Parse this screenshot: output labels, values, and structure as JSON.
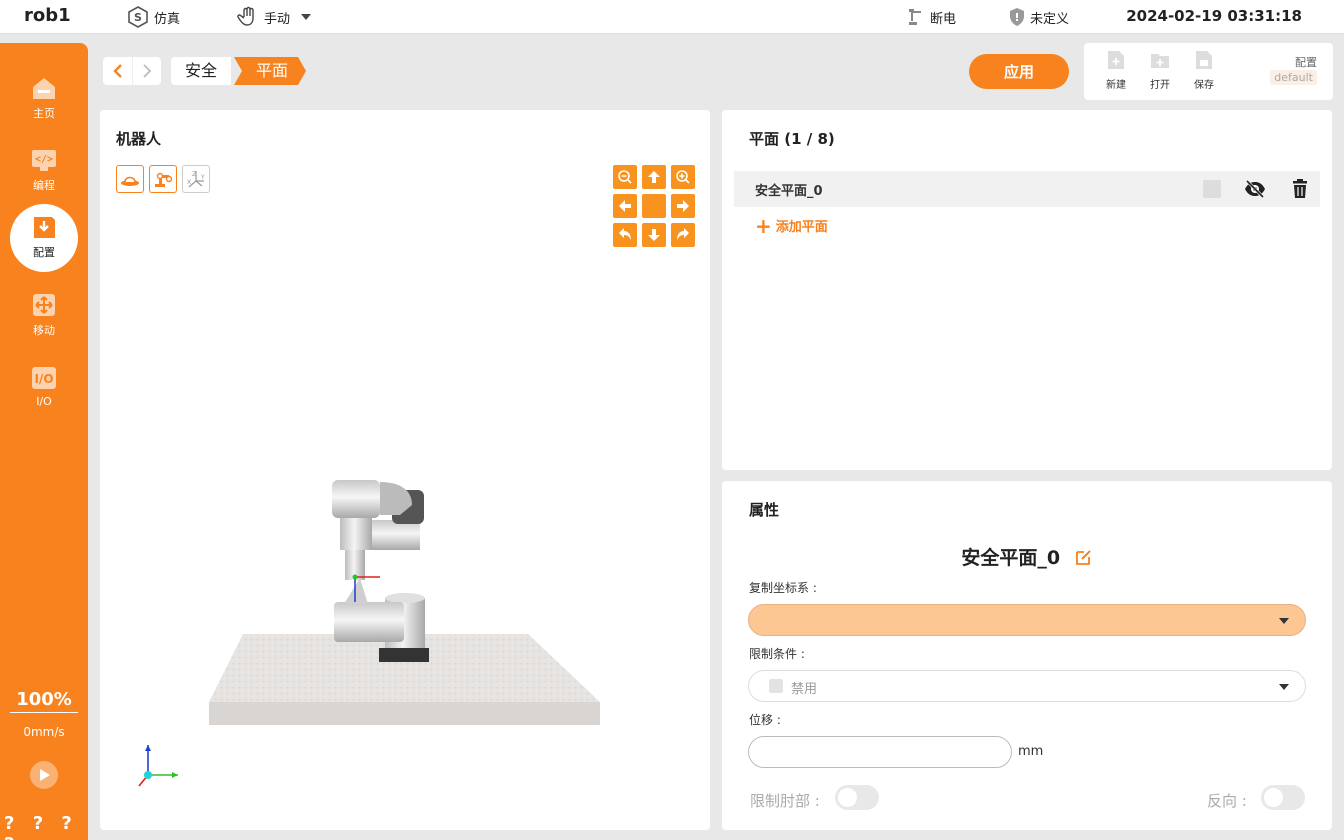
{
  "topbar": {
    "robot_name": "rob1",
    "simulation_label": "仿真",
    "mode_label": "手动",
    "power_label": "断电",
    "safety_label": "未定义",
    "datetime": "2024-02-19 03:31:18"
  },
  "sidebar": {
    "items": [
      {
        "label": "主页",
        "icon": "home-icon"
      },
      {
        "label": "编程",
        "icon": "code-icon"
      },
      {
        "label": "配置",
        "icon": "config-icon",
        "active": true
      },
      {
        "label": "移动",
        "icon": "move-icon"
      },
      {
        "label": "I/O",
        "icon": "io-icon"
      }
    ],
    "speed_percent": "100%",
    "speed_mm": "0mm/s",
    "status_marks": "? ? ? ?"
  },
  "breadcrumb": {
    "items": [
      "安全",
      "平面"
    ]
  },
  "toolbar": {
    "apply_label": "应用",
    "new_label": "新建",
    "open_label": "打开",
    "save_label": "保存",
    "config_label": "配置",
    "config_value": "default"
  },
  "robot_panel": {
    "title": "机器人"
  },
  "planes_panel": {
    "title": "平面 (1 / 8)",
    "planes": [
      {
        "name": "安全平面_0"
      }
    ],
    "add_label": "添加平面"
  },
  "props_panel": {
    "title": "属性",
    "plane_name": "安全平面_0",
    "copy_frame_label": "复制坐标系 :",
    "copy_frame_value": "",
    "limit_label": "限制条件 :",
    "limit_value": "禁用",
    "displacement_label": "位移 :",
    "displacement_value": "",
    "displacement_unit": "mm",
    "limit_elbow_label": "限制肘部 :",
    "reverse_label": "反向 :"
  },
  "colors": {
    "accent": "#f7821e",
    "select_fill": "#fdc794"
  }
}
